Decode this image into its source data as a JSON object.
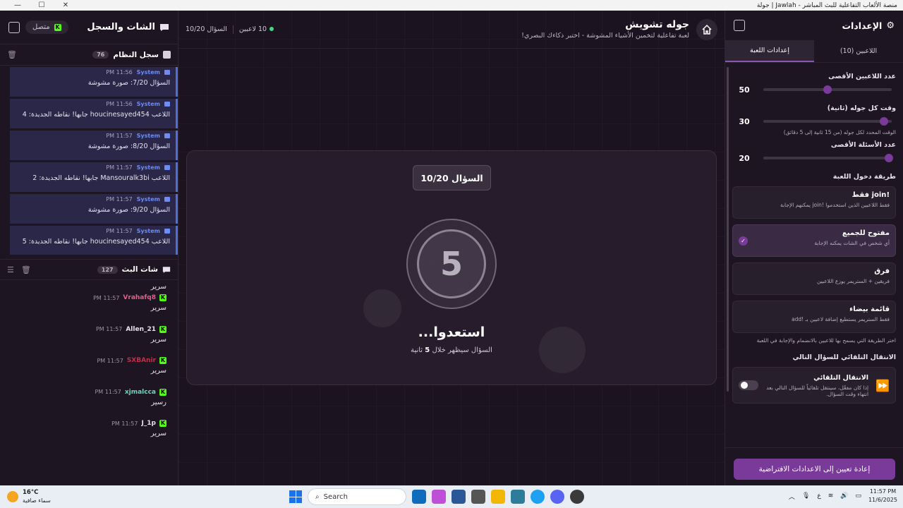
{
  "window": {
    "title": "منصة الألعاب التفاعلية للبث المباشر - Jawlah | جولة",
    "controls": [
      "—",
      "☐",
      "✕"
    ]
  },
  "left_panel": {
    "title": "الشات والسجل",
    "connection_label": "متصل",
    "system_log": {
      "title": "سجل النظام",
      "count": "76",
      "messages": [
        {
          "sender": "System",
          "time": "11:56 PM",
          "text": "السؤال 7/20: صورة مشوشة"
        },
        {
          "sender": "System",
          "time": "11:56 PM",
          "text": "اللاعب houcinesayed454 جابها! نقاطه الجديدة: 4"
        },
        {
          "sender": "System",
          "time": "11:57 PM",
          "text": "السؤال 8/20: صورة مشوشة"
        },
        {
          "sender": "System",
          "time": "11:57 PM",
          "text": "اللاعب Mansouralk3bi جابها! نقاطه الجديدة: 2"
        },
        {
          "sender": "System",
          "time": "11:57 PM",
          "text": "السؤال 9/20: صورة مشوشة"
        },
        {
          "sender": "System",
          "time": "11:57 PM",
          "text": "اللاعب houcinesayed454 جابها! نقاطه الجديدة: 5"
        }
      ]
    },
    "live_chat": {
      "title": "شات البث",
      "count": "127",
      "first_text": "سرير",
      "messages": [
        {
          "user": "Vrahafq8",
          "color": "#e0608a",
          "time": "11:57 PM",
          "text": "سرير"
        },
        {
          "user": "Allen_21",
          "color": "#e8e2ee",
          "time": "11:57 PM",
          "text": "سرير"
        },
        {
          "user": "SXBAnir",
          "color": "#c0304a",
          "time": "11:57 PM",
          "text": "سرير"
        },
        {
          "user": "xjmalcca",
          "color": "#6cd4c0",
          "time": "11:57 PM",
          "text": "رسير"
        },
        {
          "user": "J_1p",
          "color": "#e8e2ee",
          "time": "11:57 PM",
          "text": "سرير"
        }
      ]
    }
  },
  "main": {
    "title": "جوله تشويش",
    "subtitle": "لعبة تفاعلية لتخمين الأشياء المشوشة - اختبر ذكاءك البصري!",
    "players_stat": "10 لاعبين",
    "question_stat": "السؤال 10/20",
    "question_badge": "السؤال 10/20",
    "countdown": "5",
    "ready_title": "استعدوا...",
    "ready_sub_prefix": "السؤال سيظهر خلال",
    "ready_sub_number": "5",
    "ready_sub_suffix": "ثانية"
  },
  "right_panel": {
    "title": "الإعدادات",
    "tabs": [
      "اللاعبين (10)",
      "إعدادات اللعبة"
    ],
    "max_players": {
      "label": "عدد اللاعبين الأقصى",
      "value": "50",
      "fraction": 0.5
    },
    "round_time": {
      "label": "وقت كل جوله (ثانية)",
      "value": "30",
      "fraction": 0.06,
      "hint": "الوقت المحدد لكل جوله (من 15 ثانية إلى 5 دقائق)"
    },
    "max_questions": {
      "label": "عدد الأسئلة الأقصى",
      "value": "20",
      "fraction": 0.02
    },
    "entry_label": "طريقة دخول اللعبة",
    "entry_options": [
      {
        "title": "!join فقط",
        "desc": "فقط اللاعبين الذين استخدموا !join يمكنهم الإجابة"
      },
      {
        "title": "مفتوح للجميع",
        "desc": "أي شخص في الشات يمكنه الإجابة"
      },
      {
        "title": "فرق",
        "desc": "فريقين + الستريمر يوزع اللاعبين"
      },
      {
        "title": "قائمة بيضاء",
        "desc": "فقط الستريمر يستطيع إضافة لاعبين بـ !add"
      }
    ],
    "selected_entry": 1,
    "entry_hint": "اختر الطريقة التي يسمح بها للاعبين بالانضمام والإجابة في اللعبة",
    "auto_label": "الانتقال التلقائي للسؤال التالي",
    "auto_title": "الانتقال التلقائي",
    "auto_desc": "إذا كان مفعّل، سينتقل تلقائياً للسؤال التالي بعد انتهاء وقت السؤال.",
    "auto_enabled": false,
    "reset_label": "إعادة تعيين إلى الاعدادات الافتراضية"
  },
  "taskbar": {
    "temp": "16°C",
    "weather": "سماء صافية",
    "search": "Search",
    "lang": "ع",
    "time": "11:57 PM",
    "date": "11/6/2025"
  }
}
